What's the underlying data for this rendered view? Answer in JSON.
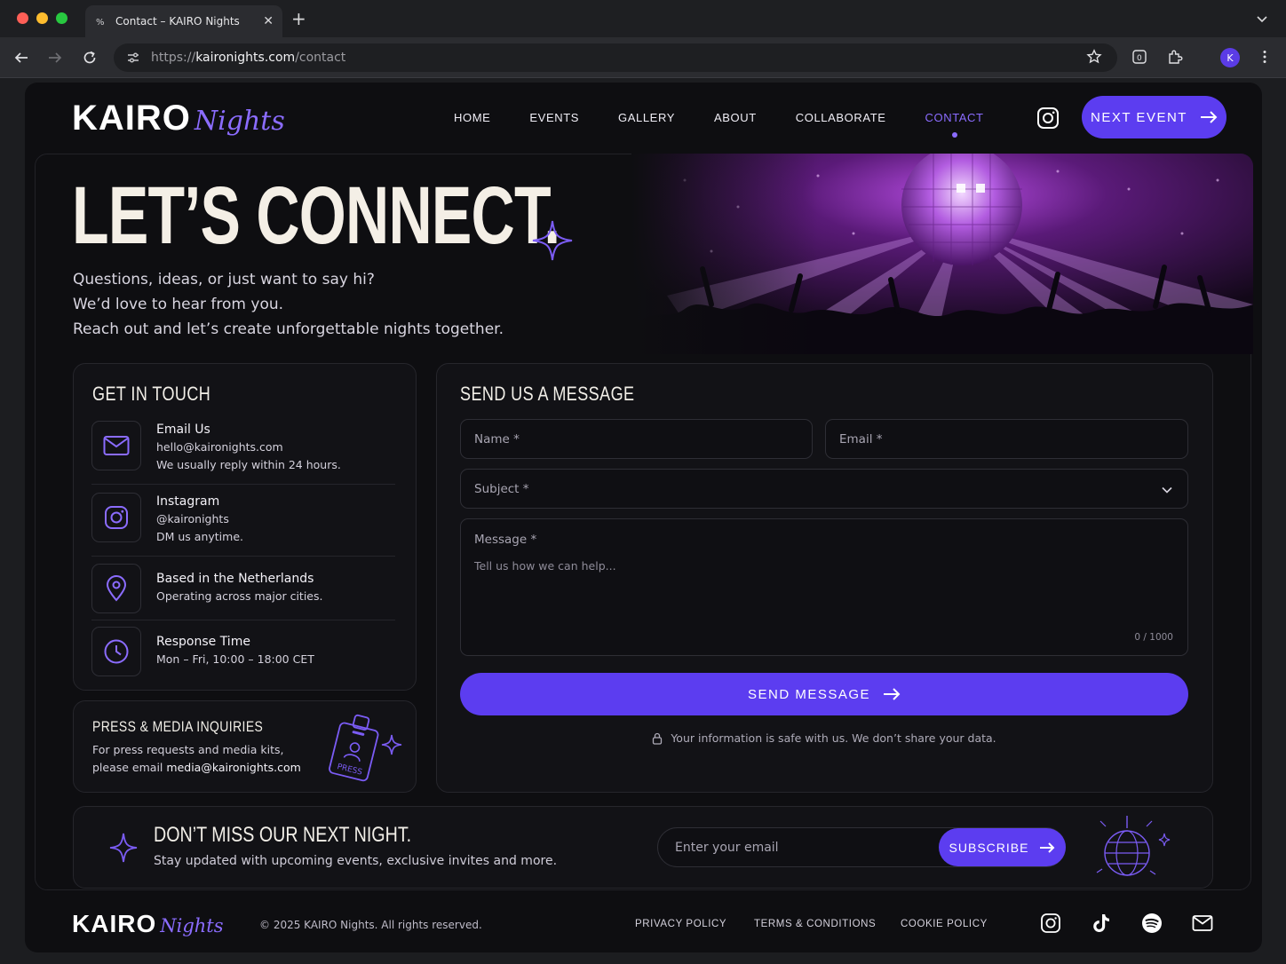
{
  "browser": {
    "tab_title": "Contact – KAIRO Nights",
    "url_scheme": "https://",
    "url_host": "kaironights.com",
    "url_path": "/contact",
    "profile_initial": "K"
  },
  "brand": {
    "logo_main": "KAIRO",
    "logo_script": "Nights",
    "accent": "#5c3df0",
    "accent_light": "#8b6cff"
  },
  "nav": {
    "items": [
      {
        "label": "HOME"
      },
      {
        "label": "EVENTS"
      },
      {
        "label": "GALLERY"
      },
      {
        "label": "ABOUT"
      },
      {
        "label": "COLLABORATE"
      },
      {
        "label": "CONTACT",
        "active": true
      }
    ],
    "cta": "NEXT EVENT"
  },
  "hero": {
    "title": "LET’S CONNECT.",
    "lines": [
      "Questions, ideas, or just want to say hi?",
      "We’d love to hear from you.",
      "Reach out and let’s create unforgettable nights together."
    ]
  },
  "contact": {
    "heading": "GET IN TOUCH",
    "items": [
      {
        "icon": "mail-icon",
        "title": "Email Us",
        "lines": [
          "hello@kaironights.com",
          "We usually reply within 24 hours."
        ]
      },
      {
        "icon": "instagram-icon",
        "title": "Instagram",
        "lines": [
          "@kaironights",
          "DM us anytime."
        ]
      },
      {
        "icon": "location-pin-icon",
        "title": "Based in the Netherlands",
        "lines": [
          "Operating across major cities."
        ]
      },
      {
        "icon": "clock-icon",
        "title": "Response Time",
        "lines": [
          "Mon – Fri, 10:00 – 18:00 CET"
        ]
      }
    ]
  },
  "press": {
    "heading": "PRESS & MEDIA INQUIRIES",
    "line1": "For press requests and media kits,",
    "line2_prefix": "please email ",
    "email": "media@kaironights.com",
    "badge": "PRESS"
  },
  "form": {
    "heading": "SEND US A MESSAGE",
    "name_placeholder": "Name *",
    "email_placeholder": "Email *",
    "subject_placeholder": "Subject *",
    "message_label": "Message *",
    "message_placeholder": "Tell us how we can help...",
    "counter": "0 / 1000",
    "submit": "SEND MESSAGE",
    "privacy": "Your information is safe with us. We don’t share your data."
  },
  "newsletter": {
    "heading": "DON’T MISS OUR NEXT NIGHT.",
    "sub": "Stay updated with upcoming events, exclusive invites and more.",
    "placeholder": "Enter your email",
    "button": "SUBSCRIBE"
  },
  "footer": {
    "copyright": "© 2025 KAIRO Nights. All rights reserved.",
    "links": [
      "PRIVACY POLICY",
      "TERMS & CONDITIONS",
      "COOKIE POLICY"
    ],
    "social": [
      "instagram-icon",
      "tiktok-icon",
      "spotify-icon",
      "mail-icon"
    ]
  }
}
